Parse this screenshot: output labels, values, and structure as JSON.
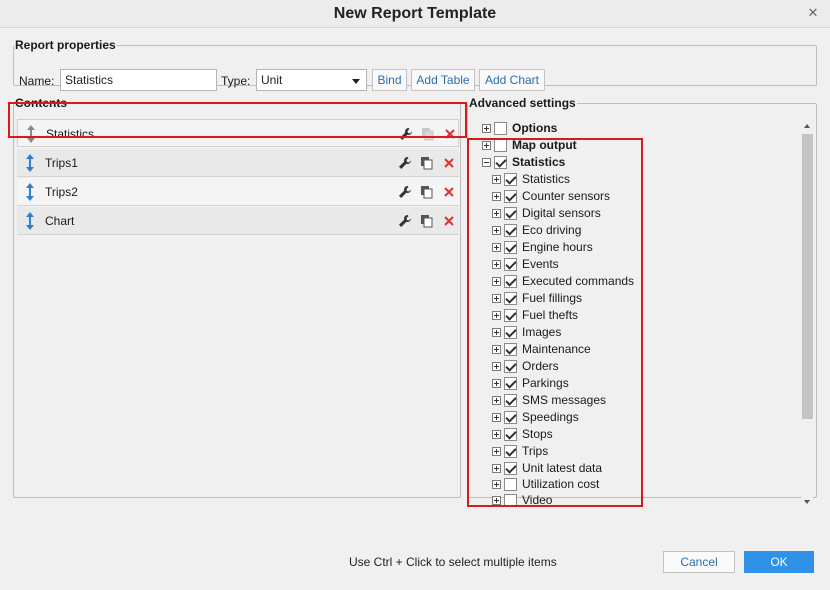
{
  "dialog": {
    "title": "New Report Template",
    "close_icon": "close-icon"
  },
  "properties": {
    "legend": "Report properties",
    "name_label": "Name:",
    "name_value": "Statistics",
    "type_label": "Type:",
    "type_value": "Unit",
    "bind_label": "Bind",
    "add_table_label": "Add Table",
    "add_chart_label": "Add Chart"
  },
  "contents": {
    "legend": "Contents",
    "items": [
      {
        "name": "Statistics",
        "selected": true,
        "arrow_color": "#8a8a8a"
      },
      {
        "name": "Trips1",
        "selected": false,
        "arrow_color": "#2f7fd1"
      },
      {
        "name": "Trips2",
        "selected": false,
        "arrow_color": "#2f7fd1"
      },
      {
        "name": "Chart",
        "selected": false,
        "arrow_color": "#2f7fd1"
      }
    ],
    "icons": [
      "wrench-icon",
      "copy-icon",
      "delete-icon"
    ]
  },
  "advanced": {
    "legend": "Advanced settings",
    "groups": [
      {
        "label": "Options",
        "expanded": false,
        "checked": false
      },
      {
        "label": "Map output",
        "expanded": false,
        "checked": false
      },
      {
        "label": "Statistics",
        "expanded": true,
        "checked": true
      }
    ],
    "statistics_children": [
      {
        "label": "Statistics",
        "checked": true
      },
      {
        "label": "Counter sensors",
        "checked": true
      },
      {
        "label": "Digital sensors",
        "checked": true
      },
      {
        "label": "Eco driving",
        "checked": true
      },
      {
        "label": "Engine hours",
        "checked": true
      },
      {
        "label": "Events",
        "checked": true
      },
      {
        "label": "Executed commands",
        "checked": true
      },
      {
        "label": "Fuel fillings",
        "checked": true
      },
      {
        "label": "Fuel thefts",
        "checked": true
      },
      {
        "label": "Images",
        "checked": true
      },
      {
        "label": "Maintenance",
        "checked": true
      },
      {
        "label": "Orders",
        "checked": true
      },
      {
        "label": "Parkings",
        "checked": true
      },
      {
        "label": "SMS messages",
        "checked": true
      },
      {
        "label": "Speedings",
        "checked": true
      },
      {
        "label": "Stops",
        "checked": true
      },
      {
        "label": "Trips",
        "checked": true
      },
      {
        "label": "Unit latest data",
        "checked": true
      },
      {
        "label": "Utilization cost",
        "checked": false
      },
      {
        "label": "Video",
        "checked": false
      }
    ]
  },
  "footer": {
    "hint": "Use Ctrl + Click to select multiple items",
    "cancel_label": "Cancel",
    "ok_label": "OK"
  },
  "colors": {
    "accent": "#2f92e6",
    "highlight": "#d91a1a",
    "link": "#2a6db0"
  }
}
